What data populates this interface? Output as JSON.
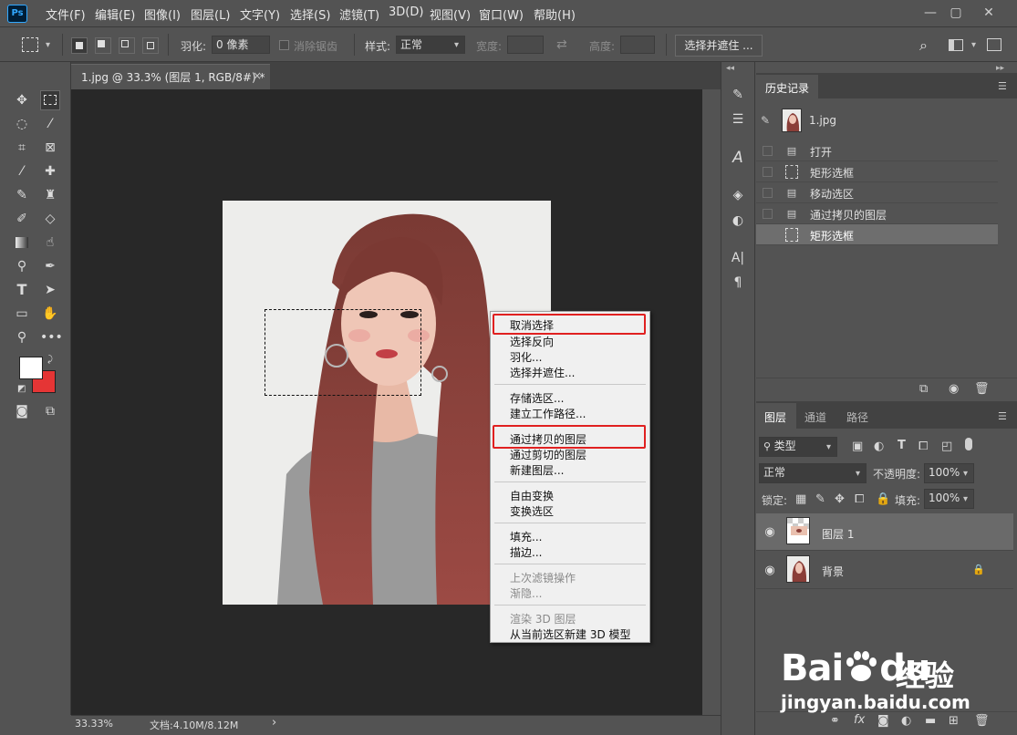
{
  "app": {
    "logo": "Ps"
  },
  "menubar": {
    "items": [
      "文件(F)",
      "编辑(E)",
      "图像(I)",
      "图层(L)",
      "文字(Y)",
      "选择(S)",
      "滤镜(T)",
      "3D(D)",
      "视图(V)",
      "窗口(W)",
      "帮助(H)"
    ]
  },
  "options": {
    "feather_label": "羽化:",
    "feather_value": "0 像素",
    "antialias_label": "消除锯齿",
    "style_label": "样式:",
    "style_value": "正常",
    "width_label": "宽度:",
    "height_label": "高度:",
    "select_mask_label": "选择并遮住 ..."
  },
  "document": {
    "tab_title": "1.jpg @ 33.3% (图层 1, RGB/8#) *",
    "close": "×"
  },
  "status": {
    "zoom": "33.33%",
    "doc_info": "文档:4.10M/8.12M",
    "arrow": "›"
  },
  "context_menu": {
    "items": [
      {
        "label": "取消选择",
        "disabled": false
      },
      {
        "label": "选择反向",
        "disabled": false
      },
      {
        "label": "羽化...",
        "disabled": false
      },
      {
        "label": "选择并遮住...",
        "disabled": false
      },
      {
        "label": "存储选区...",
        "disabled": false
      },
      {
        "label": "建立工作路径...",
        "disabled": false
      },
      {
        "label": "通过拷贝的图层",
        "disabled": false
      },
      {
        "label": "通过剪切的图层",
        "disabled": false
      },
      {
        "label": "新建图层...",
        "disabled": false
      },
      {
        "label": "自由变换",
        "disabled": false
      },
      {
        "label": "变换选区",
        "disabled": false
      },
      {
        "label": "填充...",
        "disabled": false
      },
      {
        "label": "描边...",
        "disabled": false
      },
      {
        "label": "上次滤镜操作",
        "disabled": true
      },
      {
        "label": "渐隐...",
        "disabled": true
      },
      {
        "label": "渲染 3D 图层",
        "disabled": true
      },
      {
        "label": "从当前选区新建 3D 模型",
        "disabled": false
      }
    ]
  },
  "history": {
    "tab_label": "历史记录",
    "snapshot_label": "1.jpg",
    "items": [
      "打开",
      "矩形选框",
      "移动选区",
      "通过拷贝的图层",
      "矩形选框"
    ]
  },
  "layers_panel": {
    "tabs": [
      "图层",
      "通道",
      "路径"
    ],
    "filter_kind": "类型",
    "blend_mode": "正常",
    "opacity_label": "不透明度:",
    "opacity_value": "100%",
    "lock_label": "锁定:",
    "fill_label": "填充:",
    "fill_value": "100%",
    "layers": [
      {
        "name": "图层 1",
        "selected": true,
        "locked": false
      },
      {
        "name": "背景",
        "selected": false,
        "locked": true
      }
    ],
    "fx_label": "fx"
  },
  "colors": {
    "foreground": "#ffffff",
    "background": "#e53535",
    "highlight_box": "#e02020"
  },
  "watermark": {
    "logo_text": "Bai",
    "logo_text2": "du",
    "cn_text": "经验",
    "url": "jingyan.baidu.com"
  }
}
